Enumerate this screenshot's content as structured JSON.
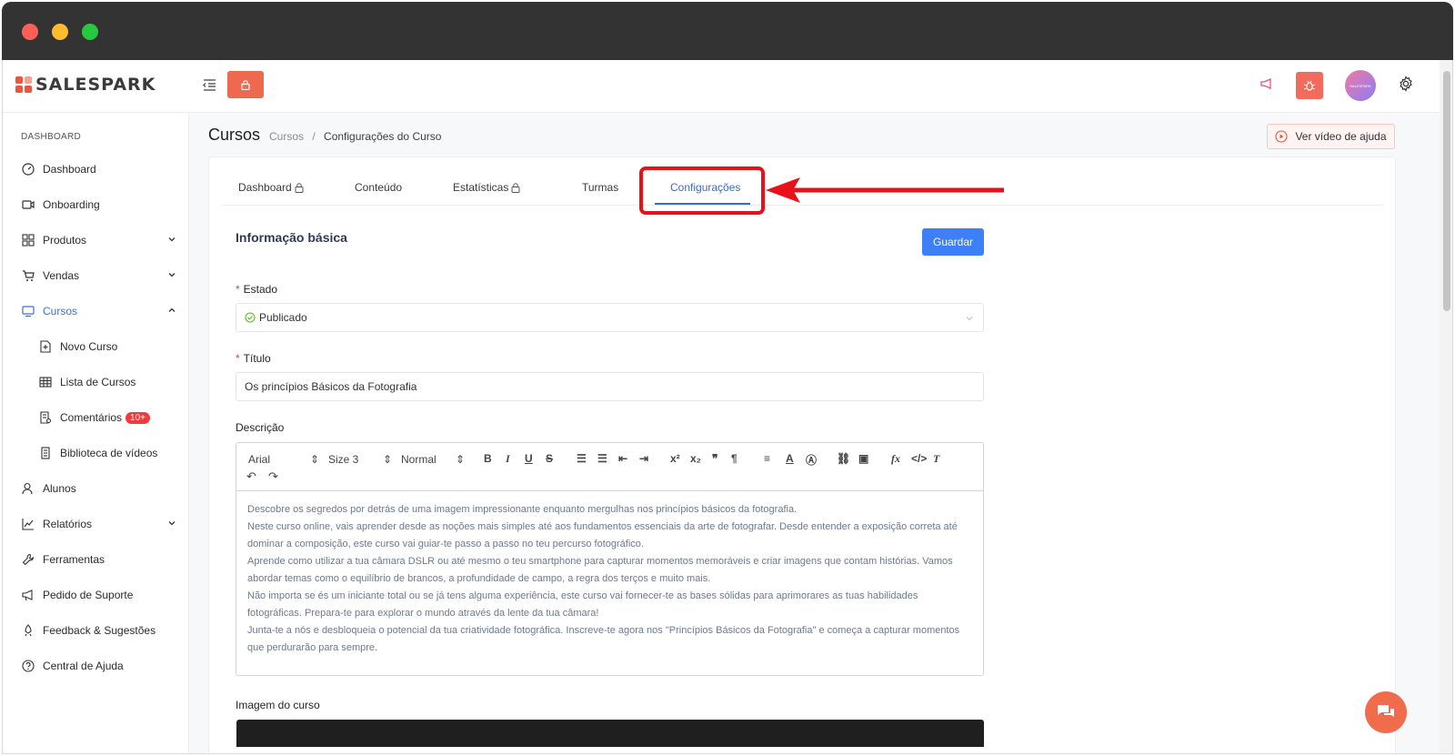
{
  "colors": {
    "accent": "#3a6ad3",
    "brand": "#e9553d",
    "highlight": "#e8111a",
    "save": "#3d7ff6"
  },
  "app": {
    "logo": "SALESPARK"
  },
  "topbar": {
    "avatar_text": "SALESPARK"
  },
  "sidebar": {
    "header": "DASHBOARD",
    "items": [
      {
        "label": "Dashboard",
        "icon": "dashboard-icon"
      },
      {
        "label": "Onboarding",
        "icon": "video-icon"
      },
      {
        "label": "Produtos",
        "icon": "grid-icon"
      },
      {
        "label": "Vendas",
        "icon": "cart-icon"
      },
      {
        "label": "Cursos",
        "icon": "monitor-icon"
      },
      {
        "label": "Novo Curso",
        "icon": "file-plus-icon"
      },
      {
        "label": "Lista de Cursos",
        "icon": "table-icon"
      },
      {
        "label": "Comentários",
        "icon": "comment-doc-icon",
        "badge": "10+"
      },
      {
        "label": "Biblioteca de vídeos",
        "icon": "library-icon"
      },
      {
        "label": "Alunos",
        "icon": "users-icon"
      },
      {
        "label": "Relatórios",
        "icon": "chart-icon"
      },
      {
        "label": "Ferramentas",
        "icon": "wrench-icon"
      },
      {
        "label": "Pedido de Suporte",
        "icon": "megaphone-icon"
      },
      {
        "label": "Feedback & Sugestões",
        "icon": "rocket-icon"
      },
      {
        "label": "Central de Ajuda",
        "icon": "help-icon"
      }
    ]
  },
  "header": {
    "title": "Cursos",
    "breadcrumb_root": "Cursos",
    "breadcrumb_sep": "/",
    "breadcrumb_current": "Configurações do Curso",
    "help_button": "Ver vídeo de ajuda"
  },
  "tabs": [
    {
      "label": "Dashboard",
      "locked": true
    },
    {
      "label": "Conteúdo",
      "locked": false
    },
    {
      "label": "Estatísticas",
      "locked": true
    },
    {
      "label": "Turmas",
      "locked": false
    },
    {
      "label": "Configurações",
      "locked": false,
      "active": true
    }
  ],
  "form": {
    "section_title": "Informação básica",
    "save_label": "Guardar",
    "estado_label": "Estado",
    "estado_value": "Publicado",
    "titulo_label": "Título",
    "titulo_value": "Os princípios Básicos da Fotografia",
    "descricao_label": "Descrição",
    "toolbar": {
      "font": "Arial",
      "size": "Size 3",
      "style": "Normal"
    },
    "descricao_lines": [
      "Descobre os segredos por detrás de uma imagem impressionante enquanto mergulhas nos princípios básicos da fotografia.",
      "Neste curso online, vais aprender desde as noções mais simples até aos fundamentos essenciais da arte de fotografar. Desde entender a exposição correta até dominar a composição, este curso vai guiar-te passo a passo no teu percurso fotográfico.",
      "Aprende como utilizar a tua câmara DSLR ou até mesmo o teu smartphone para capturar momentos memoráveis e criar imagens que contam histórias. Vamos abordar temas como o equilíbrio de brancos, a profundidade de campo, a regra dos terços e muito mais.",
      "Não importa se és um iniciante total ou se já tens alguma experiência, este curso vai fornecer-te as bases sólidas para aprimorares as tuas habilidades fotográficas. Prepara-te para explorar o mundo através da lente da tua câmara!",
      "Junta-te a nós e desbloqueia o potencial da tua criatividade fotográfica. Inscreve-te agora nos \"Princípios Básicos da Fotografia\" e começa a capturar momentos que perdurarão para sempre."
    ],
    "imagem_label": "Imagem do curso"
  }
}
